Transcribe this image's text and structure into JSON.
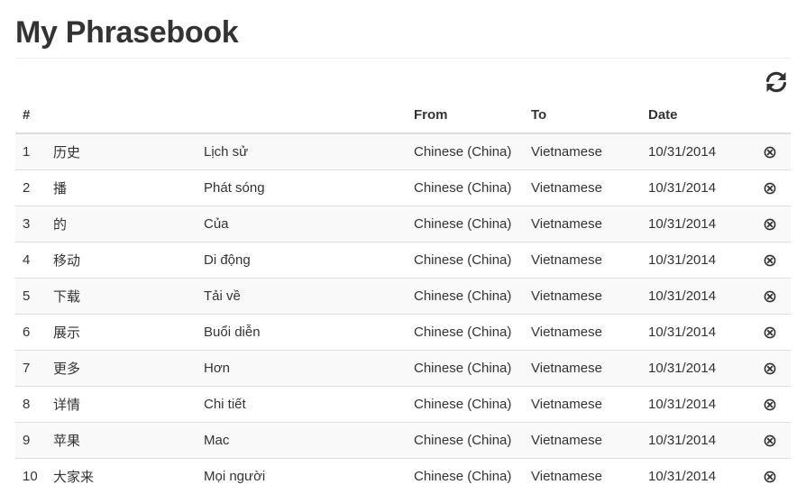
{
  "page": {
    "title": "My Phrasebook"
  },
  "toolbar": {
    "refresh_icon": "refresh-icon"
  },
  "table": {
    "headers": {
      "index": "#",
      "source": "",
      "target": "",
      "from": "From",
      "to": "To",
      "date": "Date",
      "actions": ""
    },
    "rows": [
      {
        "index": "1",
        "source": "历史",
        "target": "Lịch sử",
        "from": "Chinese (China)",
        "to": "Vietnamese",
        "date": "10/31/2014"
      },
      {
        "index": "2",
        "source": "播",
        "target": "Phát sóng",
        "from": "Chinese (China)",
        "to": "Vietnamese",
        "date": "10/31/2014"
      },
      {
        "index": "3",
        "source": "的",
        "target": "Của",
        "from": "Chinese (China)",
        "to": "Vietnamese",
        "date": "10/31/2014"
      },
      {
        "index": "4",
        "source": "移动",
        "target": "Di động",
        "from": "Chinese (China)",
        "to": "Vietnamese",
        "date": "10/31/2014"
      },
      {
        "index": "5",
        "source": "下载",
        "target": "Tải về",
        "from": "Chinese (China)",
        "to": "Vietnamese",
        "date": "10/31/2014"
      },
      {
        "index": "6",
        "source": "展示",
        "target": "Buổi diễn",
        "from": "Chinese (China)",
        "to": "Vietnamese",
        "date": "10/31/2014"
      },
      {
        "index": "7",
        "source": "更多",
        "target": "Hơn",
        "from": "Chinese (China)",
        "to": "Vietnamese",
        "date": "10/31/2014"
      },
      {
        "index": "8",
        "source": "详情",
        "target": "Chi tiết",
        "from": "Chinese (China)",
        "to": "Vietnamese",
        "date": "10/31/2014"
      },
      {
        "index": "9",
        "source": "苹果",
        "target": "Mac",
        "from": "Chinese (China)",
        "to": "Vietnamese",
        "date": "10/31/2014"
      },
      {
        "index": "10",
        "source": "大家来",
        "target": "Mọi người",
        "from": "Chinese (China)",
        "to": "Vietnamese",
        "date": "10/31/2014"
      }
    ],
    "row_action_icon": "remove-circle-icon"
  }
}
